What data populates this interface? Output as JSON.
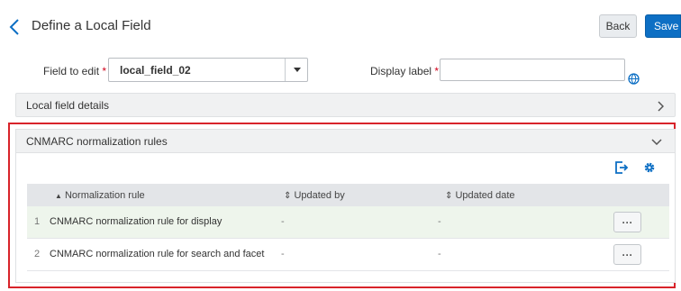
{
  "header": {
    "title": "Define a Local Field",
    "back_label": "Back",
    "save_label": "Save"
  },
  "form": {
    "field_to_edit_label": "Field to edit",
    "field_to_edit_value": "local_field_02",
    "display_label_label": "Display label",
    "display_label_value": "",
    "required_marker": "*"
  },
  "sections": {
    "local_field_details": "Local field details",
    "cnmarc_title": "CNMARC normalization rules"
  },
  "table": {
    "columns": [
      "Normalization rule",
      "Updated by",
      "Updated date"
    ],
    "sort_asc_glyph": "▲",
    "sort_both_glyph": "⇕",
    "rows": [
      {
        "index": "1",
        "rule": "CNMARC normalization rule for display",
        "updated_by": "-",
        "updated_date": "-",
        "action": "···"
      },
      {
        "index": "2",
        "rule": "CNMARC normalization rule for search and facet",
        "updated_by": "-",
        "updated_date": "-",
        "action": "···"
      }
    ]
  },
  "icons": {
    "back": "chevron-left-icon",
    "globe": "globe-icon",
    "expand": "chevron-right-icon",
    "collapse": "chevron-down-icon",
    "export": "export-icon",
    "settings": "gear-icon"
  },
  "colors": {
    "accent": "#0d6fc4",
    "required": "#d0021b",
    "highlight_frame": "#d8232a",
    "selected_row": "#eef5ec"
  }
}
